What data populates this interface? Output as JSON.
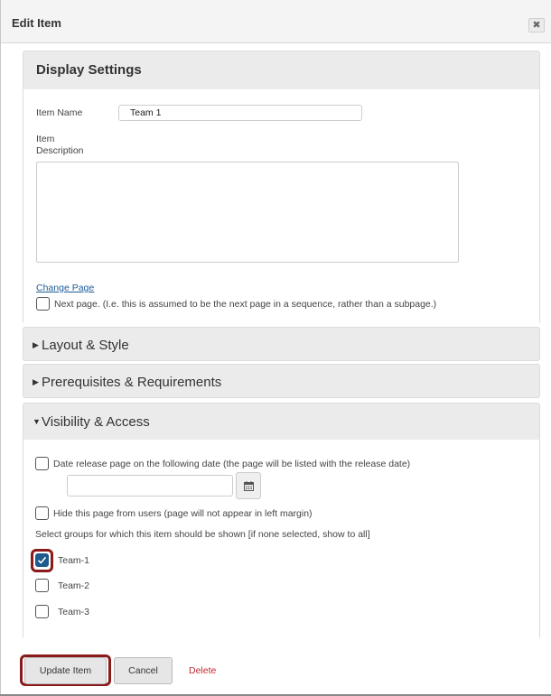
{
  "dialog": {
    "title": "Edit Item",
    "close_icon": "close-icon",
    "close_glyph": "✖"
  },
  "display_settings": {
    "heading": "Display Settings",
    "item_name_label": "Item Name",
    "item_name_value": "Team 1",
    "item_description_label_1": "Item",
    "item_description_label_2": "Description",
    "item_description_value": "",
    "change_page_link": "Change Page",
    "next_page_label": "Next page. (I.e. this is assumed to be the next page in a sequence, rather than a subpage.)",
    "next_page_checked": false
  },
  "layout_style": {
    "heading": "Layout & Style",
    "expanded": false
  },
  "prerequisites": {
    "heading": "Prerequisites & Requirements",
    "expanded": false
  },
  "visibility": {
    "heading": "Visibility & Access",
    "expanded": true,
    "date_release_label": "Date release page on the following date (the page will be listed with the release date)",
    "date_release_checked": false,
    "date_value": "",
    "calendar_icon": "calendar-icon",
    "hide_page_label": "Hide this page from users (page will not appear in left margin)",
    "hide_page_checked": false,
    "groups_label": "Select groups for which this item should be shown [if none selected, show to all]",
    "groups": [
      {
        "label": "Team-1",
        "checked": true
      },
      {
        "label": "Team-2",
        "checked": false
      },
      {
        "label": "Team-3",
        "checked": false
      }
    ]
  },
  "footer": {
    "update_label": "Update Item",
    "cancel_label": "Cancel",
    "delete_label": "Delete"
  },
  "colors": {
    "accent_checked": "#1d5a8e",
    "highlight_ring": "#8b1a1a",
    "delete_text": "#c0282d",
    "link": "#1f5c9a"
  }
}
